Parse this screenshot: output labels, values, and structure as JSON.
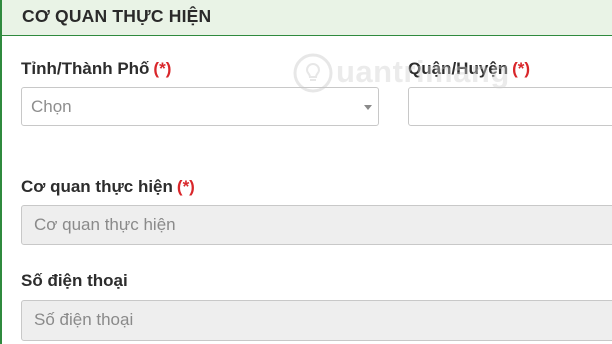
{
  "header": {
    "title": "CƠ QUAN THỰC HIỆN"
  },
  "province": {
    "label": "Tỉnh/Thành Phố",
    "required_mark": "(*)",
    "selected_value": "Chọn"
  },
  "district": {
    "label": "Quận/Huyện",
    "required_mark": "(*)",
    "selected_value": ""
  },
  "agency": {
    "label": "Cơ quan thực hiện",
    "required_mark": "(*)",
    "placeholder": "Cơ quan thực hiện"
  },
  "phone": {
    "label": "Số điện thoại",
    "placeholder": "Số điện thoại"
  },
  "watermark": {
    "text": "uantrimang",
    "icon": "lightbulb-icon"
  },
  "colors": {
    "accent_green": "#2f8a3e",
    "header_bg": "#e9f3e6",
    "required_red": "#d9262a",
    "disabled_input_bg": "#eeeeee"
  }
}
